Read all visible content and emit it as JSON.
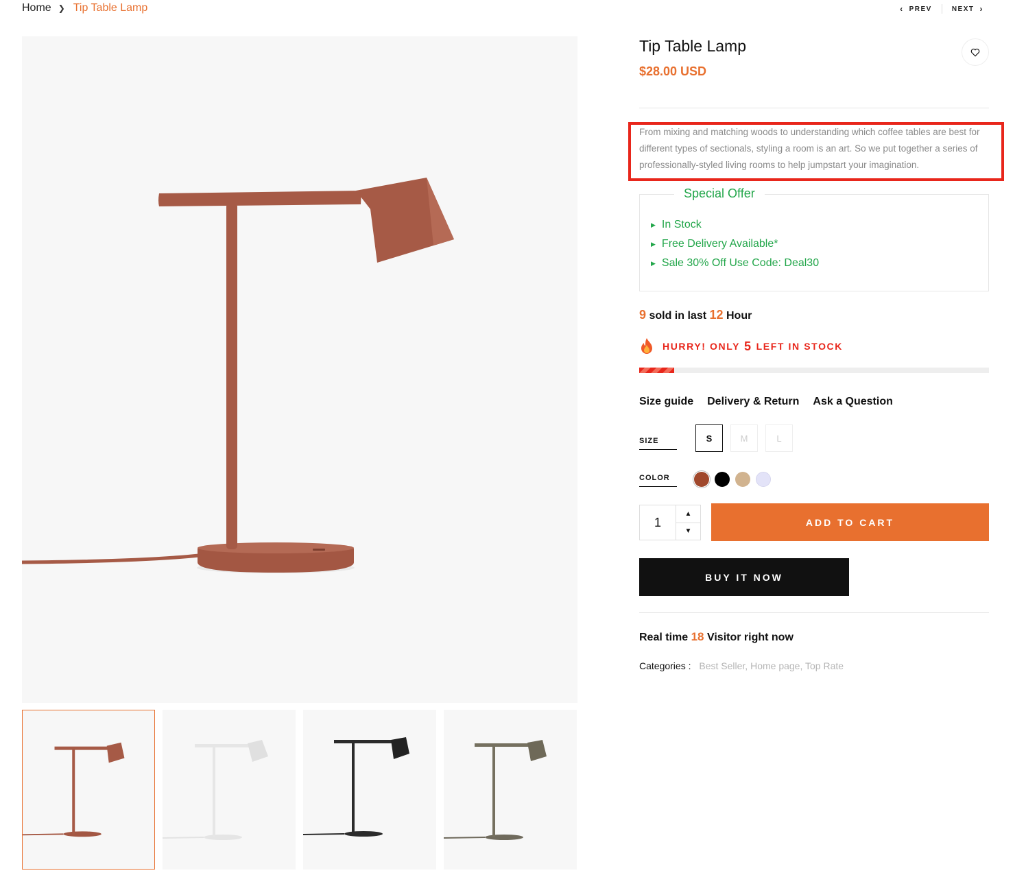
{
  "breadcrumb": {
    "home": "Home",
    "current": "Tip Table Lamp"
  },
  "nav": {
    "prev": "PREV",
    "next": "NEXT"
  },
  "product": {
    "title": "Tip Table Lamp",
    "price": "$28.00 USD",
    "description": "From mixing and matching woods to understanding which coffee tables are best for different types of sectionals, styling a room is an art. So we put together a series of professionally-styled living rooms to help jumpstart your imagination."
  },
  "special_offer": {
    "title": "Special Offer",
    "items": [
      "In Stock",
      "Free Delivery Available*",
      "Sale 30% Off Use Code: Deal30"
    ]
  },
  "sold": {
    "count": "9",
    "text_mid": "sold in last",
    "hours": "12",
    "text_end": "Hour"
  },
  "hurry": {
    "prefix": "HURRY! ONLY",
    "count": "5",
    "suffix": "LEFT IN STOCK",
    "stock_level_fraction": 0.1
  },
  "info_links": [
    "Size guide",
    "Delivery & Return",
    "Ask a Question"
  ],
  "size": {
    "label": "SIZE",
    "options": [
      "S",
      "M",
      "L"
    ],
    "selected": "S"
  },
  "color": {
    "label": "COLOR",
    "options": [
      "#a0482c",
      "#000000",
      "#d1b38f",
      "#e3e3f8"
    ],
    "selected": "#a0482c"
  },
  "quantity": {
    "value": "1"
  },
  "buttons": {
    "add_to_cart": "ADD TO CART",
    "buy_now": "BUY IT NOW"
  },
  "visitors": {
    "prefix": "Real time",
    "count": "18",
    "suffix": "Visitor right now"
  },
  "categories": {
    "label": "Categories :",
    "items": [
      "Best Seller,",
      "Home page,",
      "Top Rate"
    ]
  },
  "colors": {
    "accent": "#e8702f",
    "green": "#22a64a",
    "red": "#e8261b",
    "lamp_main": "#a65a46"
  }
}
